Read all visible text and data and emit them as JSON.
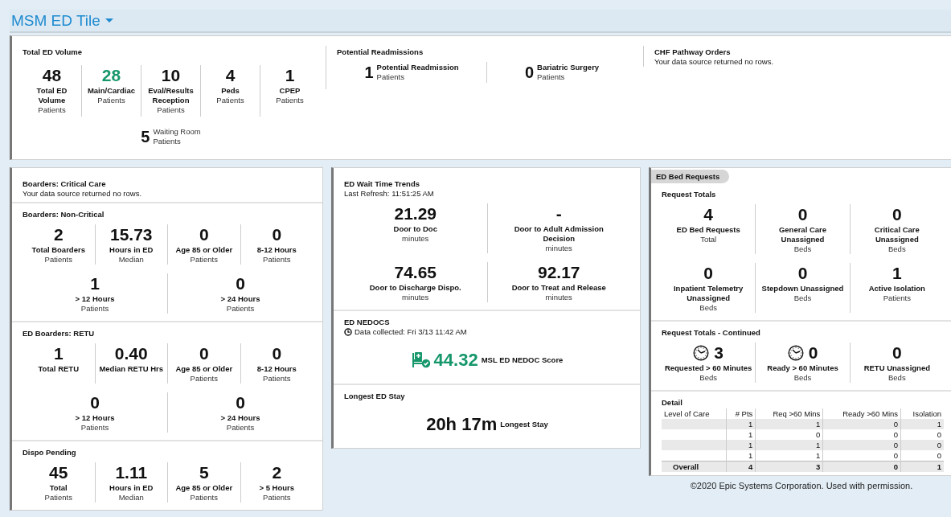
{
  "header": {
    "title": "MSM ED Tile"
  },
  "top_panel": {
    "sections": [
      {
        "title": "Total ED Volume",
        "rows": [
          {
            "kind": "stack",
            "stats": [
              {
                "value": "48",
                "label": "Total ED Volume",
                "notes": [
                  "Patients"
                ]
              },
              {
                "value": "28",
                "label": "Main/Cardiac",
                "notes": [
                  "Patients"
                ],
                "color": "#16976a"
              },
              {
                "value": "10",
                "label": "Eval/Results Reception",
                "notes": [
                  "Patients"
                ]
              },
              {
                "value": "4",
                "label": "Peds",
                "notes": [
                  "Patients"
                ]
              },
              {
                "value": "1",
                "label": "CPEP",
                "notes": [
                  "Patients"
                ]
              }
            ]
          },
          {
            "kind": "inline",
            "stats": [
              {
                "value": "5",
                "notes": [
                  "Waiting Room",
                  "Patients"
                ]
              }
            ]
          }
        ]
      },
      {
        "title": "Potential Readmissions",
        "rows": [
          {
            "kind": "inline",
            "stats": [
              {
                "value": "1",
                "label": "Potential Readmission",
                "notes": [
                  "Patients"
                ]
              },
              {
                "value": "0",
                "label": "Bariatric Surgery",
                "notes": [
                  "Patients"
                ]
              }
            ]
          }
        ]
      },
      {
        "title": "CHF Pathway Orders",
        "message": "Your data source returned no rows."
      }
    ]
  },
  "cards": [
    {
      "sections": [
        {
          "title": "Boarders: Critical Care",
          "message": "Your data source returned no rows."
        },
        {
          "title": "Boarders: Non-Critical",
          "rows": [
            {
              "kind": "stack",
              "stats": [
                {
                  "value": "2",
                  "label": "Total Boarders",
                  "notes": [
                    "Patients"
                  ]
                },
                {
                  "value": "15.73",
                  "label": "Hours in ED",
                  "notes": [
                    "Median"
                  ]
                },
                {
                  "value": "0",
                  "label": "Age 85 or Older",
                  "notes": [
                    "Patients"
                  ]
                },
                {
                  "value": "0",
                  "label": "8-12 Hours",
                  "notes": [
                    "Patients"
                  ]
                }
              ]
            },
            {
              "kind": "stack",
              "stats": [
                {
                  "value": "1",
                  "label": "> 12 Hours",
                  "notes": [
                    "Patients"
                  ]
                },
                {
                  "value": "0",
                  "label": "> 24 Hours",
                  "notes": [
                    "Patients"
                  ]
                }
              ]
            }
          ]
        },
        {
          "title": "ED Boarders: RETU",
          "rows": [
            {
              "kind": "stack",
              "stats": [
                {
                  "value": "1",
                  "label": "Total RETU"
                },
                {
                  "value": "0.40",
                  "label": "Median RETU Hrs"
                },
                {
                  "value": "0",
                  "label": "Age 85 or Older",
                  "notes": [
                    "Patients"
                  ]
                },
                {
                  "value": "0",
                  "label": "8-12 Hours",
                  "notes": [
                    "Patients"
                  ]
                }
              ]
            },
            {
              "kind": "stack",
              "stats": [
                {
                  "value": "0",
                  "label": "> 12 Hours",
                  "notes": [
                    "Patients"
                  ]
                },
                {
                  "value": "0",
                  "label": "> 24 Hours",
                  "notes": [
                    "Patients"
                  ]
                }
              ]
            }
          ]
        },
        {
          "title": "Dispo Pending",
          "rows": [
            {
              "kind": "stack",
              "stats": [
                {
                  "value": "45",
                  "label": "Total",
                  "notes": [
                    "Patients"
                  ]
                },
                {
                  "value": "1.11",
                  "label": "Hours in ED",
                  "notes": [
                    "Median"
                  ]
                },
                {
                  "value": "5",
                  "label": "Age 85 or Older",
                  "notes": [
                    "Patients"
                  ]
                },
                {
                  "value": "2",
                  "label": "> 5 Hours",
                  "notes": [
                    "Patients"
                  ]
                }
              ]
            }
          ]
        }
      ]
    },
    {
      "sections": [
        {
          "title": "ED Wait Time Trends",
          "subtitle": "Last Refresh: 11:51:25 AM",
          "rows": [
            {
              "kind": "stack",
              "stats": [
                {
                  "value": "21.29",
                  "label": "Door to Doc",
                  "notes": [
                    "minutes"
                  ]
                },
                {
                  "value": "-",
                  "label": "Door to Adult Admission Decision",
                  "notes": [
                    "minutes"
                  ]
                }
              ]
            },
            {
              "kind": "stack",
              "stats": [
                {
                  "value": "74.65",
                  "label": "Door to Discharge Dispo.",
                  "notes": [
                    "minutes"
                  ]
                },
                {
                  "value": "92.17",
                  "label": "Door to Treat and Release",
                  "notes": [
                    "minutes"
                  ]
                }
              ]
            }
          ]
        },
        {
          "title": "ED NEDOCS",
          "kind": "timestamped",
          "subtitle": "Data collected: Fri 3/13 11:42 AM",
          "rows": [
            {
              "kind": "feature",
              "stats": [
                {
                  "value": "44.32",
                  "label": "MSL ED NEDOC Score",
                  "kind": "score",
                  "color": "#16976a"
                }
              ]
            }
          ]
        },
        {
          "title": "Longest ED Stay",
          "rows": [
            {
              "kind": "feature",
              "stats": [
                {
                  "value": "20h 17m",
                  "label": "Longest Stay"
                }
              ]
            }
          ]
        }
      ]
    },
    {
      "tab": "ED Bed Requests",
      "sections": [
        {
          "title": "Request Totals",
          "rows": [
            {
              "kind": "stack",
              "stats": [
                {
                  "value": "4",
                  "label": "ED Bed Requests",
                  "notes": [
                    "Total"
                  ]
                },
                {
                  "value": "0",
                  "label": "General Care Unassigned",
                  "notes": [
                    "Beds"
                  ]
                },
                {
                  "value": "0",
                  "label": "Critical Care Unassigned",
                  "notes": [
                    "Beds"
                  ]
                }
              ]
            },
            {
              "kind": "stack",
              "stats": [
                {
                  "value": "0",
                  "label": "Inpatient Telemetry Unassigned",
                  "notes": [
                    "Beds"
                  ]
                },
                {
                  "value": "0",
                  "label": "Stepdown Unassigned",
                  "notes": [
                    "Beds"
                  ]
                },
                {
                  "value": "1",
                  "label": "Active Isolation",
                  "notes": [
                    "Patients"
                  ]
                }
              ]
            }
          ]
        },
        {
          "title": "Request Totals - Continued",
          "rows": [
            {
              "kind": "stack",
              "stats": [
                {
                  "value": "3",
                  "label": "Requested > 60 Minutes",
                  "notes": [
                    "Beds"
                  ],
                  "kind": "timed"
                },
                {
                  "value": "0",
                  "label": "Ready > 60 Minutes",
                  "notes": [
                    "Beds"
                  ],
                  "kind": "timed"
                },
                {
                  "value": "0",
                  "label": "RETU Unassigned",
                  "notes": [
                    "Beds"
                  ]
                }
              ]
            }
          ]
        },
        {
          "title": "Detail",
          "table": {
            "columns": [
              "Level of Care",
              "# Pts",
              "Req >60 Mins",
              "Ready >60 Mins",
              "Isolation"
            ],
            "rows": [
              {
                "values": [
                  "1",
                  "1",
                  "0",
                  "1"
                ]
              },
              {
                "values": [
                  "1",
                  "0",
                  "0",
                  "0"
                ]
              },
              {
                "values": [
                  "1",
                  "1",
                  "0",
                  "0"
                ]
              },
              {
                "values": [
                  "1",
                  "1",
                  "0",
                  "0"
                ]
              }
            ],
            "total": {
              "label": "Overall",
              "values": [
                "4",
                "3",
                "0",
                "1"
              ]
            }
          }
        }
      ]
    }
  ],
  "footer": {
    "text": "©2020 Epic Systems Corporation. Used with permission."
  }
}
